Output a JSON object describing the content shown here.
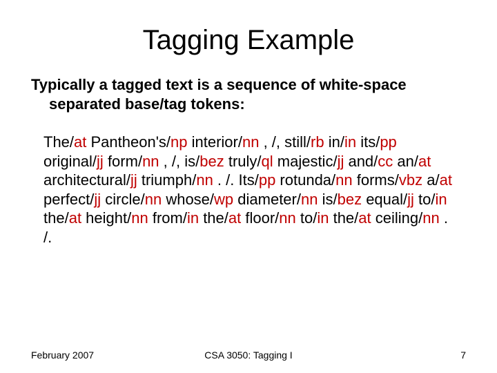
{
  "title": "Tagging Example",
  "subtitle": "Typically a tagged text is a sequence of white-space separated base/tag tokens:",
  "tokens": [
    {
      "w": " The/",
      "t": "at"
    },
    {
      "w": " Pantheon's/",
      "t": "np"
    },
    {
      "w": "  interior/",
      "t": "nn"
    },
    {
      "w": " , /, still/",
      "t": "rb"
    },
    {
      "w": " in/",
      "t": "in"
    },
    {
      "w": " its/",
      "t": "pp"
    },
    {
      "w": " original/",
      "t": "jj"
    },
    {
      "w": " form/",
      "t": "nn"
    },
    {
      "w": " , /, is/",
      "t": "bez"
    },
    {
      "w": " truly/",
      "t": "ql"
    },
    {
      "w": " majestic/",
      "t": "jj"
    },
    {
      "w": " and/",
      "t": "cc"
    },
    {
      "w": " an/",
      "t": "at"
    },
    {
      "w": " architectural/",
      "t": "jj"
    },
    {
      "w": " triumph/",
      "t": "nn"
    },
    {
      "w": " . /. Its/",
      "t": "pp"
    },
    {
      "w": " rotunda/",
      "t": "nn"
    },
    {
      "w": " forms/",
      "t": "vbz"
    },
    {
      "w": " a/",
      "t": "at"
    },
    {
      "w": " perfect/",
      "t": "jj"
    },
    {
      "w": " circle/",
      "t": "nn"
    },
    {
      "w": " whose/",
      "t": "wp"
    },
    {
      "w": " diameter/",
      "t": "nn"
    },
    {
      "w": " is/",
      "t": "bez"
    },
    {
      "w": " equal/",
      "t": "jj"
    },
    {
      "w": " to/",
      "t": "in"
    },
    {
      "w": " the/",
      "t": "at"
    },
    {
      "w": " height/",
      "t": "nn"
    },
    {
      "w": " from/",
      "t": "in"
    },
    {
      "w": " the/",
      "t": "at"
    },
    {
      "w": " floor/",
      "t": "nn"
    },
    {
      "w": " to/",
      "t": "in"
    },
    {
      "w": " the/",
      "t": "at"
    },
    {
      "w": " ceiling/",
      "t": "nn"
    },
    {
      "w": " . /.",
      "t": ""
    }
  ],
  "footer": {
    "left": "February 2007",
    "center": "CSA 3050: Tagging I",
    "right": "7"
  }
}
